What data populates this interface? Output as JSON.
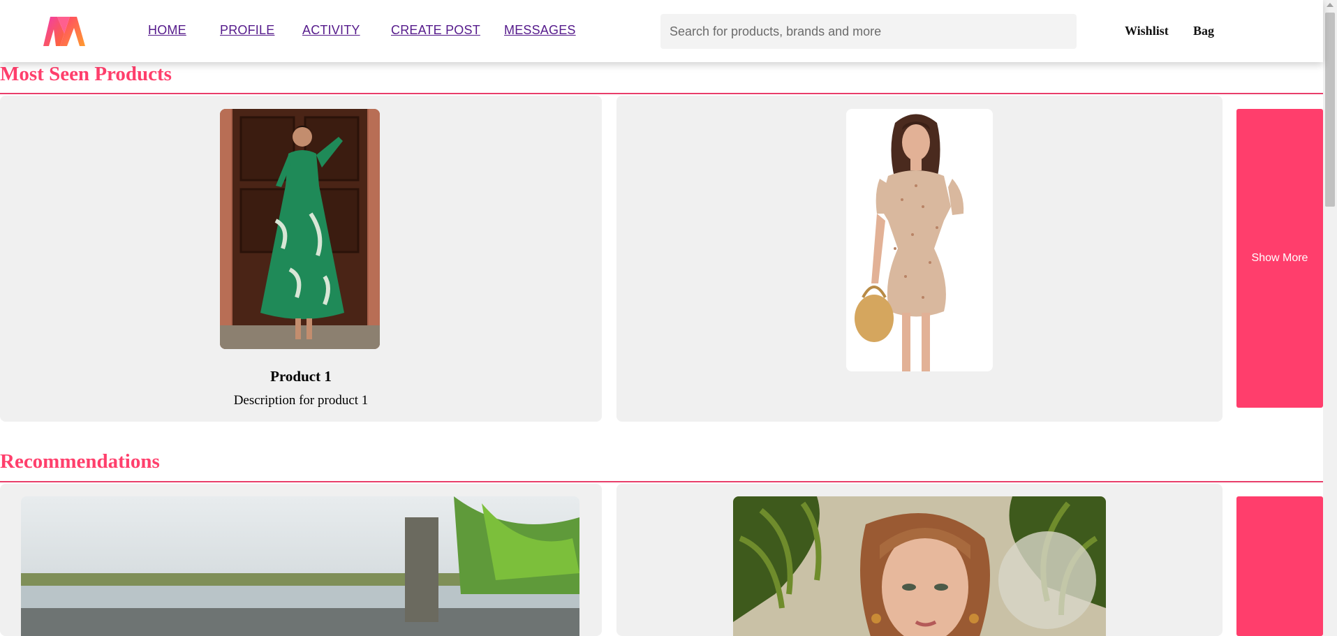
{
  "header": {
    "logo": "myntra-logo",
    "nav": [
      "HOME",
      "PROFILE",
      "ACTIVITY",
      "CREATE POST",
      "MESSAGES"
    ],
    "search_placeholder": "Search for products, brands and more",
    "wishlist": "Wishlist",
    "bag": "Bag"
  },
  "most_seen": {
    "title": "Most Seen Products",
    "products": [
      {
        "image": "green-floral-maxi-dress-photo",
        "name": "Product 1",
        "description": "Description for product 1"
      },
      {
        "image": "beige-floral-mini-dress-photo"
      }
    ],
    "show_more": "Show More"
  },
  "recommendations": {
    "title": "Recommendations",
    "images": [
      "blurred-riverbank-photo",
      "woman-with-bangs-among-palm-leaves-photo"
    ]
  },
  "colors": {
    "accent": "#ff3f6c",
    "card_bg": "#f0f0f0",
    "link": "#551a8b"
  }
}
